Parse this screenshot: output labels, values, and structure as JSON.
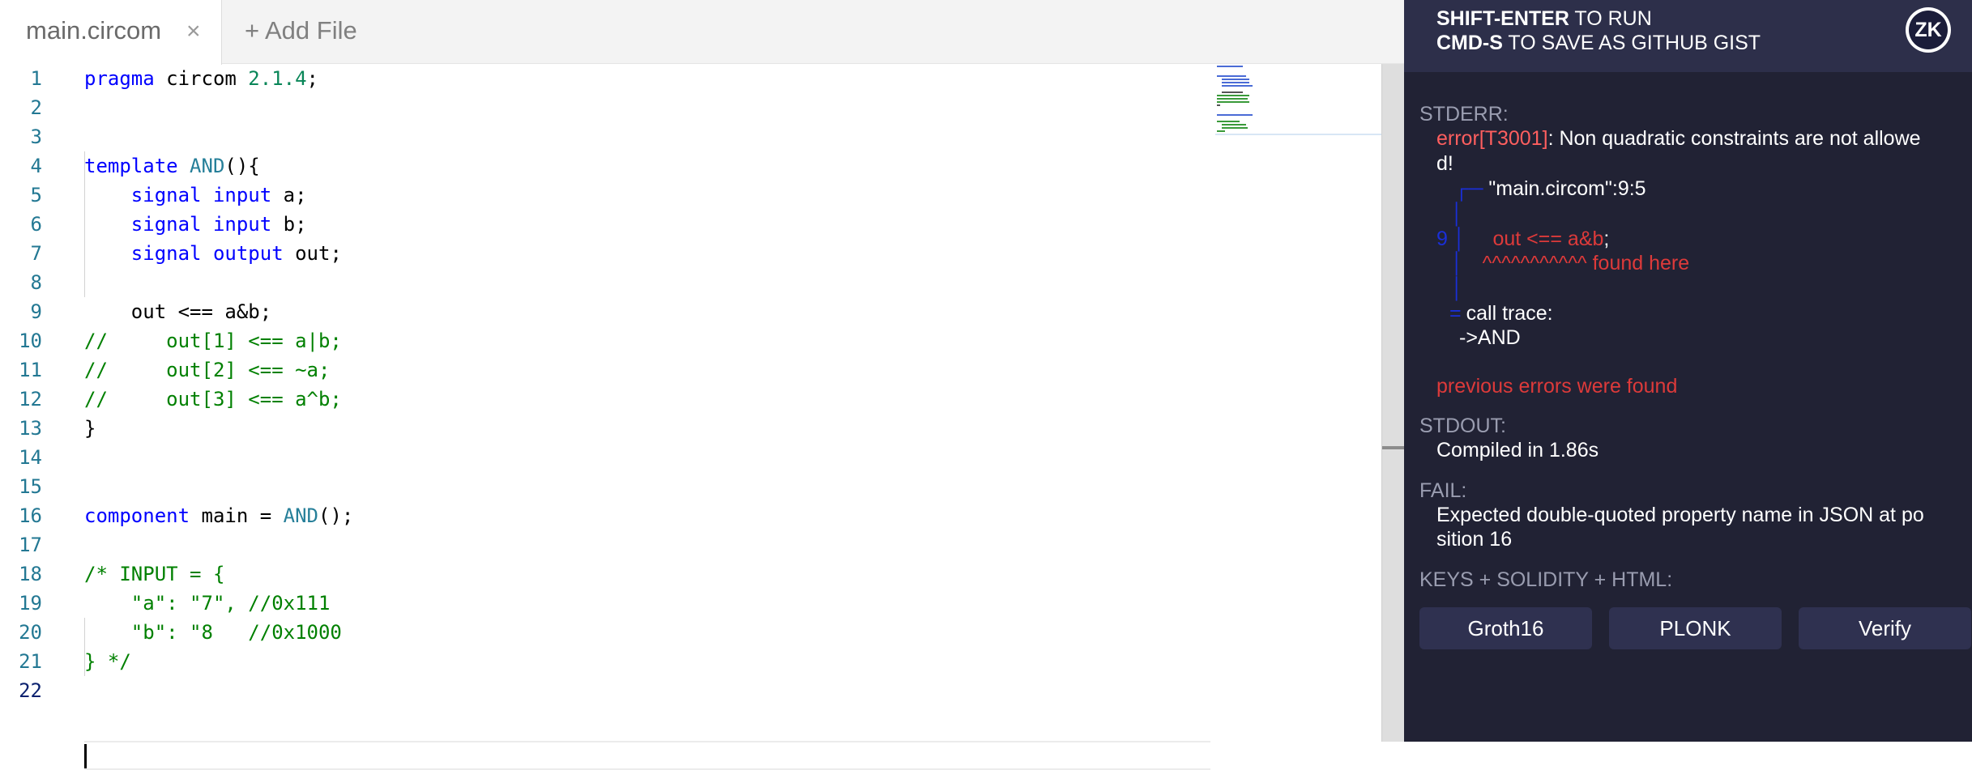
{
  "editor": {
    "tab": {
      "label": "main.circom",
      "close": "×"
    },
    "add_file": "+ Add File",
    "lines": [
      {
        "n": "1",
        "parts": [
          [
            "kw",
            "pragma"
          ],
          [
            "t",
            " circom "
          ],
          [
            "num",
            "2.1.4"
          ],
          [
            "t",
            ";"
          ]
        ]
      },
      {
        "n": "2",
        "parts": []
      },
      {
        "n": "3",
        "parts": []
      },
      {
        "n": "4",
        "parts": [
          [
            "kw",
            "template"
          ],
          [
            "t",
            " "
          ],
          [
            "fn",
            "AND"
          ],
          [
            "t",
            "(){"
          ]
        ]
      },
      {
        "n": "5",
        "parts": [
          [
            "t",
            "    "
          ],
          [
            "kw",
            "signal"
          ],
          [
            "t",
            " "
          ],
          [
            "kw",
            "input"
          ],
          [
            "t",
            " a;"
          ]
        ]
      },
      {
        "n": "6",
        "parts": [
          [
            "t",
            "    "
          ],
          [
            "kw",
            "signal"
          ],
          [
            "t",
            " "
          ],
          [
            "kw",
            "input"
          ],
          [
            "t",
            " b;"
          ]
        ]
      },
      {
        "n": "7",
        "parts": [
          [
            "t",
            "    "
          ],
          [
            "kw",
            "signal"
          ],
          [
            "t",
            " "
          ],
          [
            "kw",
            "output"
          ],
          [
            "t",
            " out;"
          ]
        ]
      },
      {
        "n": "8",
        "parts": []
      },
      {
        "n": "9",
        "parts": [
          [
            "t",
            "    out <== a&b;"
          ]
        ]
      },
      {
        "n": "10",
        "parts": [
          [
            "cmt",
            "//     out[1] <== a|b;"
          ]
        ]
      },
      {
        "n": "11",
        "parts": [
          [
            "cmt",
            "//     out[2] <== ~a;"
          ]
        ]
      },
      {
        "n": "12",
        "parts": [
          [
            "cmt",
            "//     out[3] <== a^b;"
          ]
        ]
      },
      {
        "n": "13",
        "parts": [
          [
            "t",
            "}"
          ]
        ]
      },
      {
        "n": "14",
        "parts": []
      },
      {
        "n": "15",
        "parts": []
      },
      {
        "n": "16",
        "parts": [
          [
            "kw",
            "component"
          ],
          [
            "t",
            " main = "
          ],
          [
            "fn",
            "AND"
          ],
          [
            "t",
            "();"
          ]
        ]
      },
      {
        "n": "17",
        "parts": []
      },
      {
        "n": "18",
        "parts": [
          [
            "cmt",
            "/* INPUT = {"
          ]
        ]
      },
      {
        "n": "19",
        "parts": [
          [
            "cmt",
            "    \"a\": \"7\", //0x111"
          ]
        ]
      },
      {
        "n": "20",
        "parts": [
          [
            "cmt",
            "    \"b\": \"8   //0x1000"
          ]
        ]
      },
      {
        "n": "21",
        "parts": [
          [
            "cmt",
            "} */"
          ]
        ]
      },
      {
        "n": "22",
        "parts": []
      }
    ]
  },
  "panel": {
    "hint_run": {
      "key": "SHIFT-ENTER",
      "text": " TO RUN"
    },
    "hint_save": {
      "key": "CMD-S",
      "text": " TO SAVE AS GITHUB GIST"
    },
    "logo": "ZK",
    "stderr_label": "STDERR:",
    "error_code": "error[T3001]",
    "error_msg_1": ": Non quadratic constraints are not allowe",
    "error_msg_2": "d!",
    "trace_corner": "┌─",
    "trace_file": " \"main.circom\":9:5",
    "pipe": "│",
    "trace_lineno": "9 │",
    "trace_code": "out <== a&b",
    "trace_semicolon": ";",
    "trace_carets": "^^^^^^^^^^^ found here",
    "trace_eq": "=",
    "call_trace": "call trace:",
    "call_and": "->AND",
    "prev_errors": "previous errors were found",
    "stdout_label": "STDOUT:",
    "stdout_text": "Compiled in 1.86s",
    "fail_label": "FAIL:",
    "fail_text_1": "Expected double-quoted property name in JSON at po",
    "fail_text_2": "sition 16",
    "keys_label": "KEYS + SOLIDITY + HTML:",
    "buttons": [
      "Groth16",
      "PLONK",
      "Verify"
    ]
  }
}
